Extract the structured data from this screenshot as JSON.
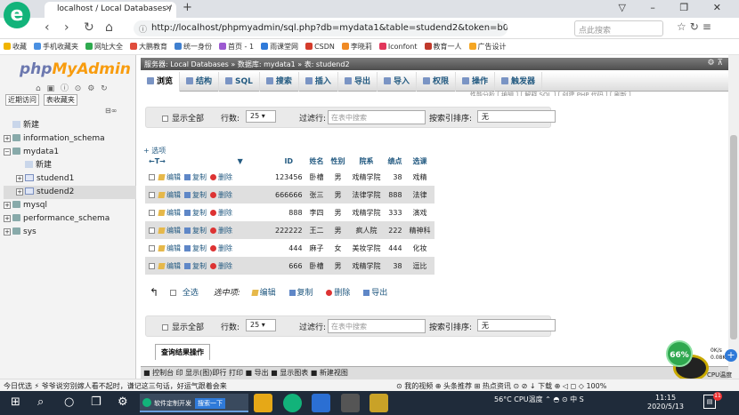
{
  "browser": {
    "logo_letter": "e",
    "tab_title": "localhost / Local Databases /",
    "tab_close": "✕",
    "new_tab": "+",
    "window_controls": "▽ – ❐ ✕",
    "url": "http://localhost/phpmyadmin/sql.php?db=mydata1&table=studend2&token=b0f1c12686f0694",
    "search_placeholder": "点此搜索",
    "bookmarks": [
      {
        "label": "收藏",
        "color": "#f0b400"
      },
      {
        "label": "手机收藏夹",
        "color": "#4a90e2"
      },
      {
        "label": "网址大全",
        "color": "#2faa4f"
      },
      {
        "label": "大鹏教育",
        "color": "#e04c3c"
      },
      {
        "label": "统一身份",
        "color": "#3f7fcf"
      },
      {
        "label": "首页 - 1",
        "color": "#9c59d1"
      },
      {
        "label": "雨课堂网",
        "color": "#2f7ad9"
      },
      {
        "label": "CSDN",
        "color": "#d43c2c"
      },
      {
        "label": "李晓莉",
        "color": "#f08a24"
      },
      {
        "label": "Iconfont",
        "color": "#e2365b"
      },
      {
        "label": "教育一人",
        "color": "#c0392b"
      },
      {
        "label": "广告设计",
        "color": "#f5a623"
      }
    ]
  },
  "left": {
    "logo_php": "php",
    "logo_my": "MyAdmin",
    "recent": "近期访问",
    "favorites": "表收藏夹",
    "collapse": "⊟∞",
    "tree": [
      {
        "label": "新建",
        "kind": "new",
        "indent": 0,
        "expander": ""
      },
      {
        "label": "information_schema",
        "kind": "db",
        "indent": 0,
        "expander": "+"
      },
      {
        "label": "mydata1",
        "kind": "db",
        "indent": 0,
        "expander": "−"
      },
      {
        "label": "新建",
        "kind": "new",
        "indent": 1,
        "expander": ""
      },
      {
        "label": "studend1",
        "kind": "table",
        "indent": 1,
        "expander": "+"
      },
      {
        "label": "studend2",
        "kind": "table",
        "indent": 1,
        "expander": "+",
        "selected": true
      },
      {
        "label": "mysql",
        "kind": "db",
        "indent": 0,
        "expander": "+"
      },
      {
        "label": "performance_schema",
        "kind": "db",
        "indent": 0,
        "expander": "+"
      },
      {
        "label": "sys",
        "kind": "db",
        "indent": 0,
        "expander": "+"
      }
    ]
  },
  "main": {
    "breadcrumb": "服务器: Local Databases » 数据库: mydata1 » 表: studend2",
    "crumb_controls": "⚙ ⊼",
    "tabs": [
      {
        "label": "浏览",
        "active": true
      },
      {
        "label": "结构"
      },
      {
        "label": "SQL"
      },
      {
        "label": "搜索"
      },
      {
        "label": "插入"
      },
      {
        "label": "导出"
      },
      {
        "label": "导入"
      },
      {
        "label": "权限"
      },
      {
        "label": "操作"
      },
      {
        "label": "触发器"
      }
    ],
    "profiling_text": "性能分析 [ 编辑 ] [ 解释 SQL ] [ 创建 PHP 代码 ] [ 刷新 ]",
    "filter": {
      "show_all": "显示全部",
      "rows_label": "行数:",
      "rows_value": "25 ▾",
      "filter_label": "过滤行:",
      "filter_placeholder": "在表中搜索",
      "sort_label": "按索引排序:",
      "sort_value": "无"
    },
    "options_link": "+ 选项",
    "sort_arrows": "←T→",
    "sort_marker": "▼",
    "columns": [
      "ID",
      "姓名",
      "性别",
      "院系",
      "绩点",
      "选课"
    ],
    "actions": {
      "edit": "编辑",
      "copy": "复制",
      "delete": "删除"
    },
    "rows": [
      [
        "123456",
        "卧槽",
        "男",
        "戏精学院",
        "38",
        "戏精"
      ],
      [
        "666666",
        "张三",
        "男",
        "法律学院",
        "888",
        "法律"
      ],
      [
        "888",
        "李四",
        "男",
        "戏精学院",
        "333",
        "演戏"
      ],
      [
        "222222",
        "王二",
        "男",
        "疯人院",
        "222",
        "精神科"
      ],
      [
        "444",
        "麻子",
        "女",
        "美妆学院",
        "444",
        "化妆"
      ],
      [
        "666",
        "卧槽",
        "男",
        "戏精学院",
        "38",
        "逗比"
      ]
    ],
    "bulk": {
      "select_all": "全选",
      "selected_label": "选中项:",
      "edit": "编辑",
      "copy": "复制",
      "delete": "删除",
      "export": "导出"
    },
    "query_ops": "查询结果操作",
    "console": "■ 控制台 印 显示(图)即行 打印 ■ 导出 ■ 显示图表 ■ 新建视图"
  },
  "perf": {
    "percent": "66%",
    "up": "0K/s",
    "down": "0.08K/s",
    "temp_label": "CPU温度",
    "plus": "+"
  },
  "status": {
    "left": "今日优选   ⚡ 爷爷说穷别嫁人看不起时，谦记这三句话，好运气跟着会来",
    "right": "⊙ 我的视频  ⊕ 头条推荐  ⊞ 热点资讯  ⊙  ⊘  ↓ 下载  ⊕  ◁  ◻  ◇  100%"
  },
  "taskbar": {
    "browser_label": "软件定制开发",
    "browser_btn": "搜索一下",
    "tray": "56°C CPU温度  ⌃ ◓ ⊙ 中 S",
    "time": "11:15",
    "date": "2020/5/13",
    "notif_count": "11"
  }
}
